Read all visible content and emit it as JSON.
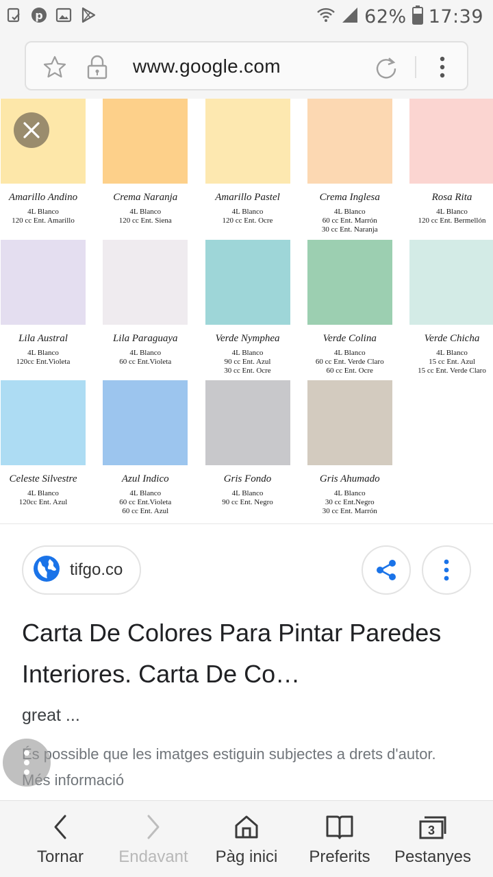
{
  "status_bar": {
    "battery": "62%",
    "time": "17:39",
    "icons": [
      "tasks-icon",
      "pinterest-icon",
      "gallery-icon",
      "play-store-icon",
      "wifi-icon",
      "signal-icon",
      "battery-icon"
    ]
  },
  "browser": {
    "url": "www.google.com",
    "icons": [
      "star-icon",
      "lock-icon",
      "reload-icon",
      "menu-icon"
    ]
  },
  "swatches": [
    {
      "name": "Amarillo Andino",
      "lines": [
        "4L Blanco",
        "120 cc Ent. Amarillo"
      ],
      "color": "#fde7a9"
    },
    {
      "name": "Crema Naranja",
      "lines": [
        "4L Blanco",
        "120 cc Ent. Siena"
      ],
      "color": "#fdd08a"
    },
    {
      "name": "Amarillo Pastel",
      "lines": [
        "4L Blanco",
        "120 cc Ent. Ocre"
      ],
      "color": "#fde8b0"
    },
    {
      "name": "Crema Inglesa",
      "lines": [
        "4L Blanco",
        "60 cc Ent. Marrón",
        "30 cc Ent. Naranja"
      ],
      "color": "#fcd8b2"
    },
    {
      "name": "Rosa Rita",
      "lines": [
        "4L Blanco",
        "120 cc Ent. Bermellón"
      ],
      "color": "#fbd5d1"
    },
    {
      "name": "Lila Austral",
      "lines": [
        "4L Blanco",
        "120cc Ent.Violeta"
      ],
      "color": "#e4def0"
    },
    {
      "name": "Lila Paraguaya",
      "lines": [
        "4L Blanco",
        "60 cc Ent.Violeta"
      ],
      "color": "#efebef"
    },
    {
      "name": "Verde Nymphea",
      "lines": [
        "4L Blanco",
        "90 cc Ent. Azul",
        "30 cc Ent. Ocre"
      ],
      "color": "#9ed6d8"
    },
    {
      "name": "Verde Colina",
      "lines": [
        "4L Blanco",
        "60 cc Ent. Verde Claro",
        "60 cc Ent. Ocre"
      ],
      "color": "#9ccfb1"
    },
    {
      "name": "Verde Chicha",
      "lines": [
        "4L Blanco",
        "15 cc Ent. Azul",
        "15 cc Ent. Verde Claro"
      ],
      "color": "#d3ebe6"
    },
    {
      "name": "Celeste Silvestre",
      "lines": [
        "4L Blanco",
        "120cc Ent. Azul"
      ],
      "color": "#addcf3"
    },
    {
      "name": "Azul Indico",
      "lines": [
        "4L Blanco",
        "60 cc Ent.Violeta",
        "60 cc Ent. Azul"
      ],
      "color": "#9cc5ee"
    },
    {
      "name": "Gris Fondo",
      "lines": [
        "4L Blanco",
        "90 cc Ent. Negro"
      ],
      "color": "#c8c8cb"
    },
    {
      "name": "Gris Ahumado",
      "lines": [
        "4L Blanco",
        "30 cc Ent.Negro",
        "30 cc Ent. Marrón"
      ],
      "color": "#d3cbbf"
    }
  ],
  "result": {
    "source": "tifgo.co",
    "title": "Carta De Colores Para Pintar Paredes Interiores. Carta De Co…",
    "description": "great ...",
    "copyright": "És possible que les imatges estiguin subjectes a drets d'autor. Més informació"
  },
  "bottom_nav": {
    "back": "Tornar",
    "forward": "Endavant",
    "home": "Pàg inici",
    "bookmarks": "Preferits",
    "tabs": "Pestanyes",
    "tab_count": "3"
  },
  "colors": {
    "accent_blue": "#1a73e8",
    "status_bar_bg": "#f5f5f5"
  }
}
